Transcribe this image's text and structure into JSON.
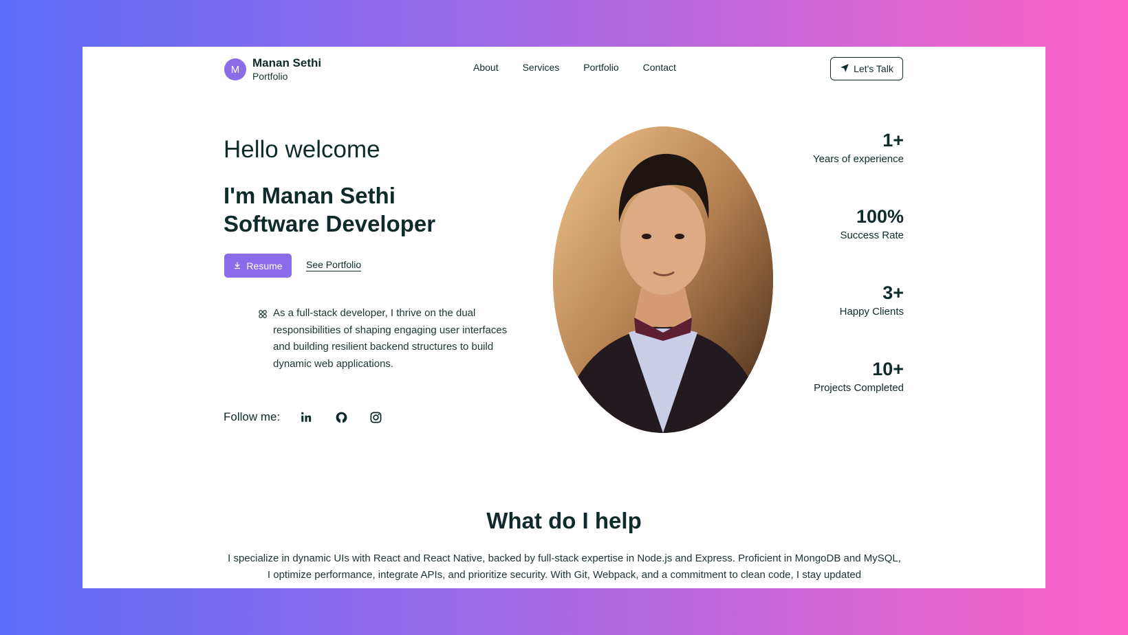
{
  "brand": {
    "initial": "M",
    "name": "Manan Sethi",
    "subtitle": "Portfolio"
  },
  "nav": {
    "items": [
      "About",
      "Services",
      "Portfolio",
      "Contact"
    ]
  },
  "cta": {
    "talk_label": "Let's Talk"
  },
  "hero": {
    "greeting": "Hello welcome",
    "intro_line1": "I'm Manan Sethi",
    "intro_line2": "Software Developer",
    "resume_label": "Resume",
    "portfolio_link": "See Portfolio",
    "description": "As a full-stack developer, I thrive on the dual responsibilities of shaping engaging user interfaces and building resilient backend structures to build dynamic web applications.",
    "follow_label": "Follow me:"
  },
  "social": {
    "icons": [
      "linkedin-icon",
      "github-icon",
      "instagram-icon"
    ]
  },
  "stats": [
    {
      "value": "1+",
      "label": "Years of experience"
    },
    {
      "value": "100%",
      "label": "Success Rate"
    },
    {
      "value": "3+",
      "label": "Happy Clients"
    },
    {
      "value": "10+",
      "label": "Projects Completed"
    }
  ],
  "section": {
    "title": "What do I help",
    "text": "I specialize in dynamic UIs with React and React Native, backed by full-stack expertise in Node.js and Express. Proficient in MongoDB and MySQL, I optimize performance, integrate APIs, and prioritize security. With Git, Webpack, and a commitment to clean code, I stay updated"
  },
  "colors": {
    "accent": "#8b6ce8",
    "text": "#0f2a2a",
    "background_start": "#5b6cf8",
    "background_end": "#ff63c6"
  }
}
